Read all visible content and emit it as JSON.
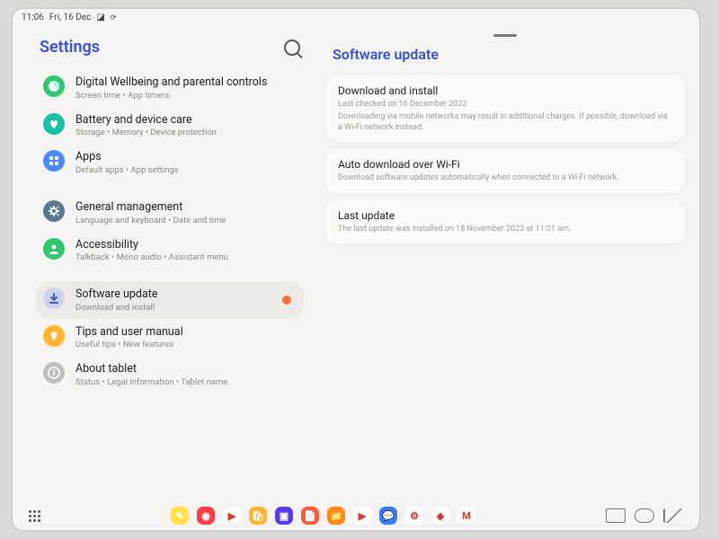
{
  "status": {
    "time": "11:06",
    "date": "Fri, 16 Dec"
  },
  "sidebar": {
    "title": "Settings",
    "groups": [
      [
        {
          "label": "Digital Wellbeing and parental controls",
          "sub": "Screen time • App timers",
          "color": "#2fc86e",
          "shape": "pie"
        },
        {
          "label": "Battery and device care",
          "sub": "Storage • Memory • Device protection",
          "color": "#17c1a3",
          "shape": "heart"
        },
        {
          "label": "Apps",
          "sub": "Default apps • App settings",
          "color": "#4a8cff",
          "shape": "grid"
        }
      ],
      [
        {
          "label": "General management",
          "sub": "Language and keyboard • Date and time",
          "color": "#5a7a8c",
          "shape": "gear"
        },
        {
          "label": "Accessibility",
          "sub": "Talkback • Mono audio • Assistant menu",
          "color": "#2fc86e",
          "shape": "person"
        }
      ],
      [
        {
          "label": "Software update",
          "sub": "Download and install",
          "color": "#cfd2e8",
          "shape": "arrow",
          "selected": true,
          "badge": true
        },
        {
          "label": "Tips and user manual",
          "sub": "Useful tips • New features",
          "color": "#ffb530",
          "shape": "bulb"
        },
        {
          "label": "About tablet",
          "sub": "Status • Legal information • Tablet name",
          "color": "#bfc0bc",
          "shape": "info"
        }
      ]
    ]
  },
  "main": {
    "title": "Software update",
    "cards": [
      {
        "title": "Download and install",
        "sub1": "Last checked on 16 December 2022",
        "sub2": "Downloading via mobile networks may result in additional charges. If possible, download via a Wi-Fi network instead."
      },
      {
        "title": "Auto download over Wi-Fi",
        "sub1": "Download software updates automatically when connected to a Wi-Fi network."
      },
      {
        "title": "Last update",
        "sub1": "The last update was installed on 18 November 2022 at 11:01 am."
      }
    ]
  },
  "dock": [
    {
      "bg": "#ffe14a",
      "glyph": "✎"
    },
    {
      "bg": "#ff3a4a",
      "glyph": "◉"
    },
    {
      "bg": "#ffffff",
      "glyph": "▶"
    },
    {
      "bg": "#ffb530",
      "glyph": "🛍"
    },
    {
      "bg": "#5a3ae8",
      "glyph": "▣"
    },
    {
      "bg": "#ff5a3a",
      "glyph": "📄"
    },
    {
      "bg": "#ff8a1a",
      "glyph": "📁"
    },
    {
      "bg": "#ffffff",
      "glyph": "▶"
    },
    {
      "bg": "#3a7aff",
      "glyph": "💬"
    },
    {
      "bg": "#ffffff",
      "glyph": "⚙"
    },
    {
      "bg": "#ffffff",
      "glyph": "◆"
    },
    {
      "bg": "#ffffff",
      "glyph": "M"
    }
  ]
}
